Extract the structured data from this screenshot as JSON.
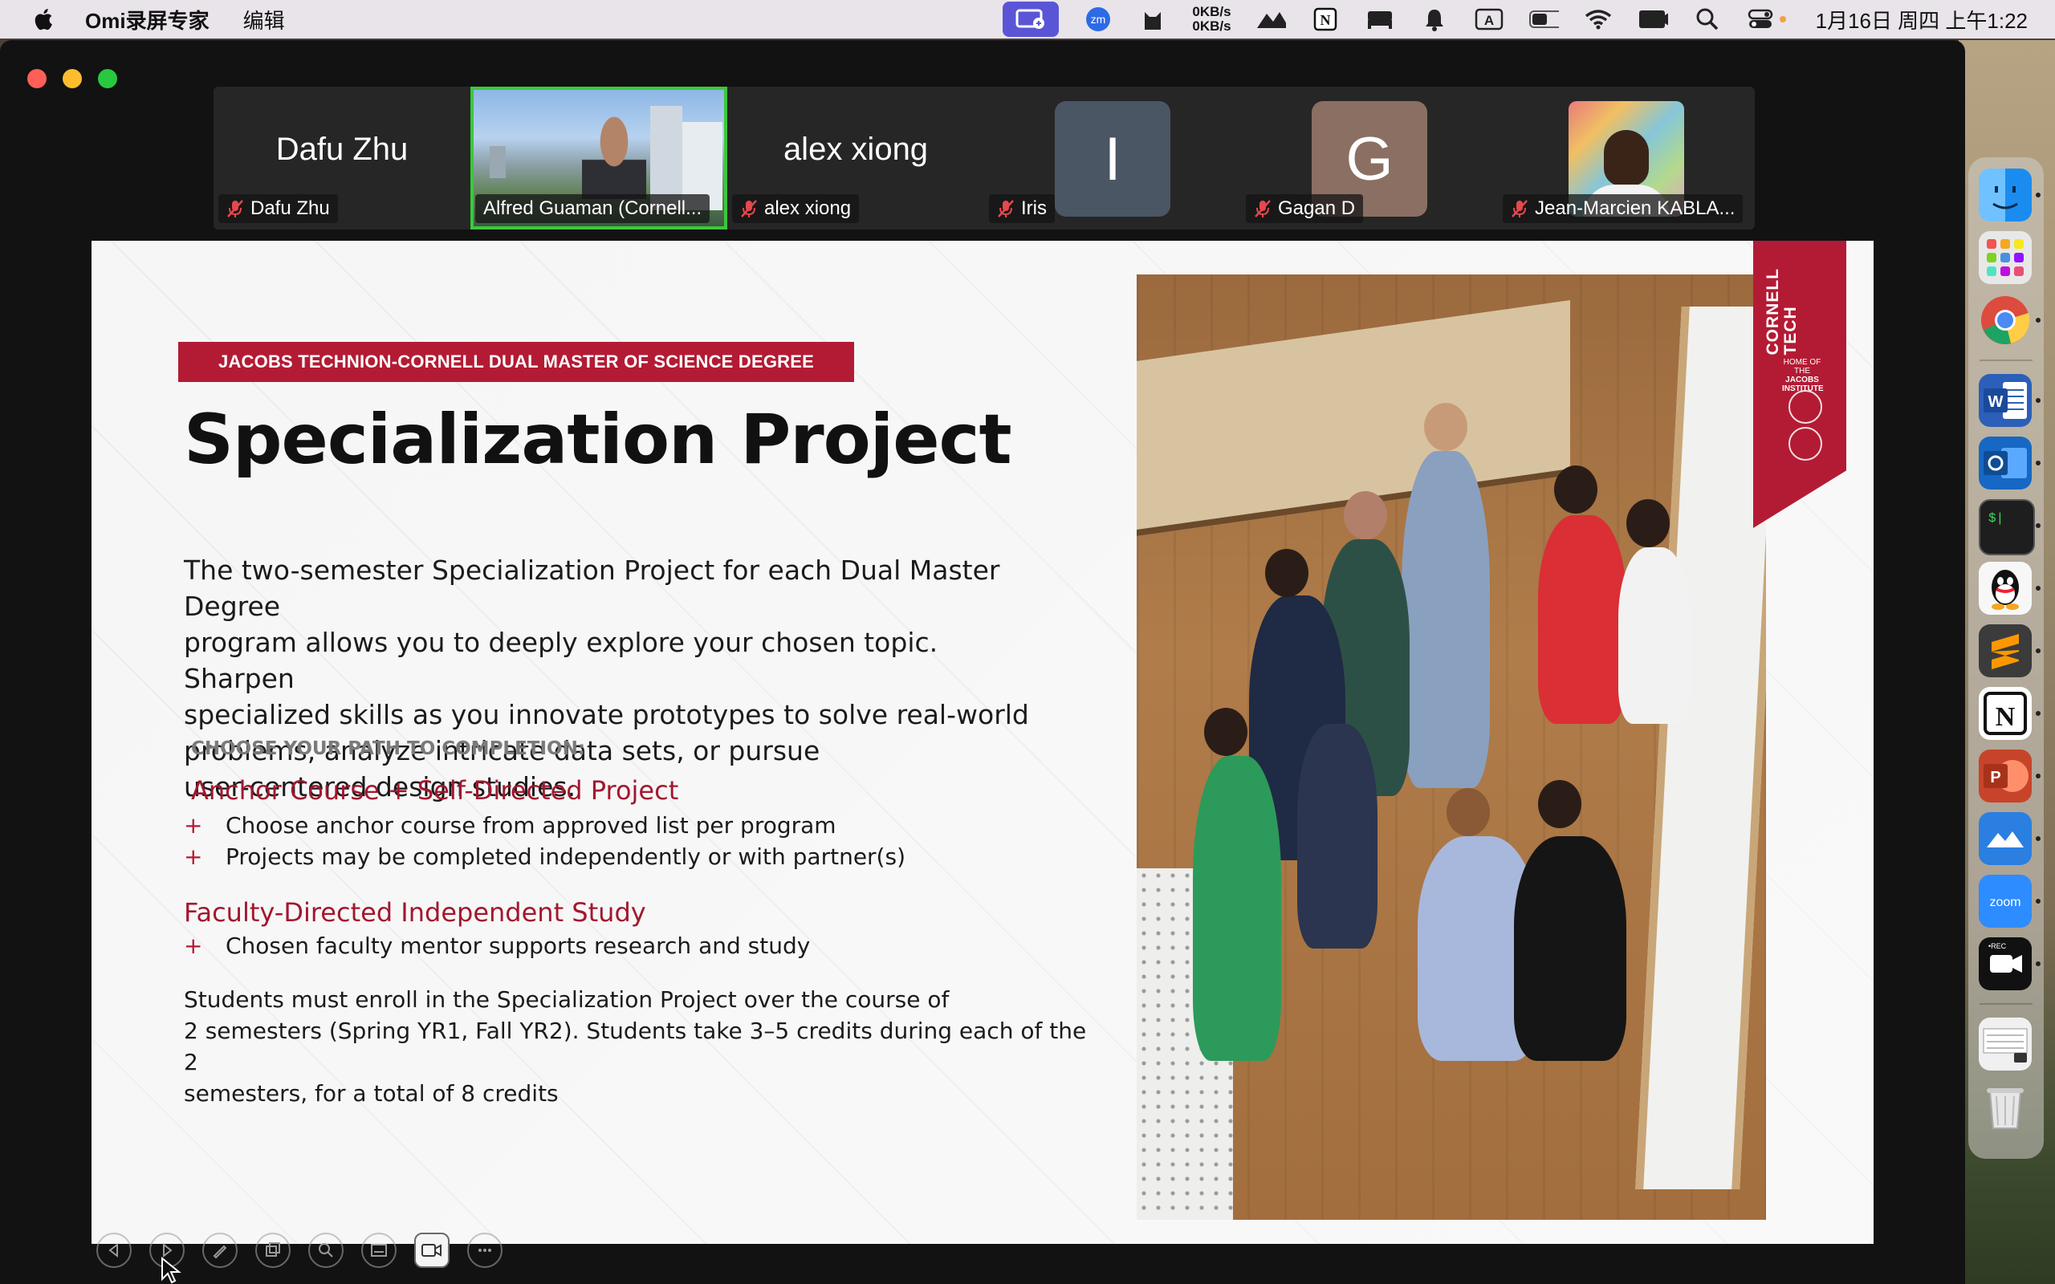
{
  "menubar": {
    "app_name": "Omi录屏专家",
    "menu_edit": "编辑",
    "net_up": "0KB/s",
    "net_down": "0KB/s",
    "clock": "1月16日 周四 上午1:22"
  },
  "participants": [
    {
      "display": "Dafu Zhu",
      "label": "Dafu Zhu",
      "muted": true,
      "type": "name"
    },
    {
      "label": "Alfred Guaman (Cornell...",
      "muted": false,
      "type": "video",
      "active": true
    },
    {
      "display": "alex xiong",
      "label": "alex xiong",
      "muted": true,
      "type": "name"
    },
    {
      "display": "I",
      "label": "Iris",
      "muted": true,
      "type": "avatar",
      "color": "#4a5664"
    },
    {
      "display": "G",
      "label": "Gagan D",
      "muted": true,
      "type": "avatar",
      "color": "#8b6f63"
    },
    {
      "label": "Jean-Marcien KABLA...",
      "muted": true,
      "type": "photo"
    }
  ],
  "slide": {
    "kicker": "JACOBS TECHNION-CORNELL DUAL MASTER OF SCIENCE DEGREE",
    "title": "Specialization Project",
    "intro_lines": [
      "The two-semester Specialization Project for each Dual Master Degree",
      "program allows you to deeply explore your chosen topic. Sharpen",
      "specialized skills as you innovate prototypes to solve real-world",
      "problems, analyze intricate data sets, or pursue",
      "user-centered design studies."
    ],
    "choose_label": "CHOOSE YOUR PATH TO COMPLETION:",
    "path1": {
      "heading": "Anchor Course + Self-Directed Project",
      "bullets": [
        "Choose anchor course from approved list per program",
        "Projects may be completed independently or with partner(s)"
      ]
    },
    "path2": {
      "heading": "Faculty-Directed Independent Study",
      "bullets": [
        "Chosen faculty mentor supports research and study"
      ]
    },
    "bullet_marker": "+",
    "note_lines": [
      "Students must enroll in the Specialization Project over the course of",
      "2 semesters (Spring YR1, Fall YR2). Students take 3–5 credits during each of the 2",
      "semesters, for a total of 8 credits"
    ],
    "ribbon": {
      "word_line1": "CORNELL",
      "word_line2": "TECH",
      "sub_line1": "HOME OF THE",
      "sub_line2": "JACOBS",
      "sub_line3": "INSTITUTE"
    }
  },
  "slide_tools": [
    "prev-icon",
    "next-icon",
    "pen-icon",
    "copy-icon",
    "zoom-icon",
    "subtitles-icon",
    "camera-icon",
    "more-icon"
  ],
  "dock": [
    {
      "name": "finder",
      "color": "#3c9be8"
    },
    {
      "name": "launchpad",
      "color": "#e0e0e0"
    },
    {
      "name": "chrome",
      "color": "#ffffff"
    },
    {
      "name": "word",
      "color": "#2b5fb8"
    },
    {
      "name": "outlook",
      "color": "#1668c4"
    },
    {
      "name": "terminal",
      "color": "#1e1e1e"
    },
    {
      "name": "qq",
      "color": "#ffffff"
    },
    {
      "name": "sublime",
      "color": "#3b3b3b"
    },
    {
      "name": "notion",
      "color": "#ffffff"
    },
    {
      "name": "powerpoint",
      "color": "#c7442a"
    },
    {
      "name": "lanhu",
      "color": "#2a7fe0"
    },
    {
      "name": "zoom",
      "color": "#2d8cff"
    },
    {
      "name": "screen-recorder",
      "color": "#111111"
    },
    {
      "name": "downloads",
      "color": "#f0f0f0"
    },
    {
      "name": "trash",
      "color": "#d8d8d8"
    }
  ],
  "dock_labels": {
    "zoom": "zoom",
    "rec": "•REC",
    "word": "W",
    "ppt": "P",
    "notion": "N",
    "terminal": "$|"
  }
}
